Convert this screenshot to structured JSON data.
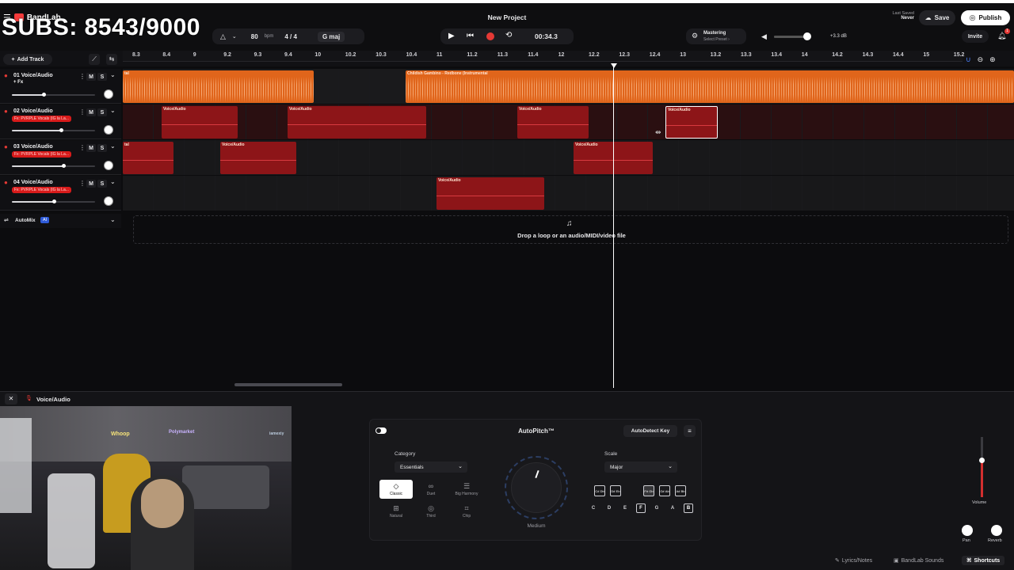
{
  "overlay": {
    "subs_text": "SUBS: 8543/9000"
  },
  "app": {
    "brand": "BandLab",
    "project_title": "New Project"
  },
  "header": {
    "tempo": "80",
    "tempo_unit": "bpm",
    "time_signature": "4 / 4",
    "key": "maj",
    "time_display": "00:34.3",
    "mastering_label": "Mastering",
    "mastering_preset": "Select Preset ›",
    "volume_db": "+3.3 dB",
    "last_saved_label": "Last Saved",
    "last_saved_value": "Never",
    "save_label": "Save",
    "publish_label": "Publish",
    "invite_label": "Invite",
    "notification_count": "1"
  },
  "toolbar": {
    "add_track_label": "Add Track"
  },
  "ruler": {
    "ticks": [
      "8.3",
      "8.4",
      "9",
      "9.2",
      "9.3",
      "9.4",
      "10",
      "10.2",
      "10.3",
      "10.4",
      "11",
      "11.2",
      "11.3",
      "11.4",
      "12",
      "12.2",
      "12.3",
      "12.4",
      "13",
      "13.2",
      "13.3",
      "13.4",
      "14",
      "14.2",
      "14.3",
      "14.4",
      "15",
      "15.2"
    ]
  },
  "tracks": [
    {
      "name": "01  Voice/Audio",
      "fx": "+ Fx",
      "fx_badge": false,
      "volume": 0.38
    },
    {
      "name": "02  Voice/Audio",
      "fx": "Fx: PVRPLE Vocals (IG la La...",
      "fx_badge": true,
      "volume": 0.59
    },
    {
      "name": "03  Voice/Audio",
      "fx": "Fx: PVRPLE Vocals (IG la La...",
      "fx_badge": true,
      "volume": 0.62
    },
    {
      "name": "04  Voice/Audio",
      "fx": "Fx: PVRPLE Vocals (IG la La...",
      "fx_badge": true,
      "volume": 0.5
    }
  ],
  "clips": {
    "track1": [
      {
        "title": "tal"
      },
      {
        "title": "Childish Gambino - Redbone (Instrumental"
      }
    ],
    "track2": [
      {
        "title": "Voice/Audio"
      },
      {
        "title": "Voice/Audio"
      },
      {
        "title": "Voice/Audio"
      },
      {
        "title": "Voice/Audio"
      }
    ],
    "track3": [
      {
        "title": "tal"
      },
      {
        "title": "Voice/Audio"
      },
      {
        "title": "Voice/Audio"
      }
    ],
    "track4": [
      {
        "title": "Voice/Audio"
      }
    ]
  },
  "automix": {
    "label": "AutoMix",
    "badge": "AI"
  },
  "drop_zone": {
    "text": "Drop a loop or an audio/MIDI/video file"
  },
  "bottom_panel": {
    "track_label": "Voice/Audio",
    "autopitch": {
      "title": "AutoPitch™",
      "autodetect_label": "AutoDetect Key",
      "category_label": "Category",
      "category_value": "Essentials",
      "styles": [
        "Classic",
        "Duet",
        "Big Harmony",
        "Natural",
        "Third",
        "Chip"
      ],
      "active_style": "Classic",
      "knob_label": "Medium",
      "scale_label": "Scale",
      "scale_value": "Major",
      "sharps": [
        {
          "top": "C#",
          "bottom": "Db",
          "selected": false
        },
        {
          "top": "D#",
          "bottom": "Eb",
          "selected": false
        },
        {
          "top": "F#",
          "bottom": "Gb",
          "selected": true
        },
        {
          "top": "G#",
          "bottom": "Ab",
          "selected": false
        },
        {
          "top": "A#",
          "bottom": "Bb",
          "selected": false
        }
      ],
      "naturals": [
        {
          "note": "C",
          "selected": false
        },
        {
          "note": "D",
          "selected": false
        },
        {
          "note": "E",
          "selected": false
        },
        {
          "note": "F",
          "selected": true
        },
        {
          "note": "G",
          "selected": false
        },
        {
          "note": "A",
          "selected": false
        },
        {
          "note": "B",
          "selected": true
        }
      ]
    },
    "right": {
      "volume_label": "Volume",
      "pan_label": "Pan",
      "reverb_label": "Reverb"
    }
  },
  "webcam_signs": {
    "left": "Whoop",
    "middle": "Polymarket",
    "right": "iamexiy"
  },
  "footer": {
    "lyrics_label": "Lyrics/Notes",
    "sounds_label": "BandLab Sounds",
    "shortcuts_label": "Shortcuts"
  },
  "colors": {
    "accent": "#e53935",
    "orange_clip": "#e0651b",
    "red_clip": "#8d1518"
  }
}
